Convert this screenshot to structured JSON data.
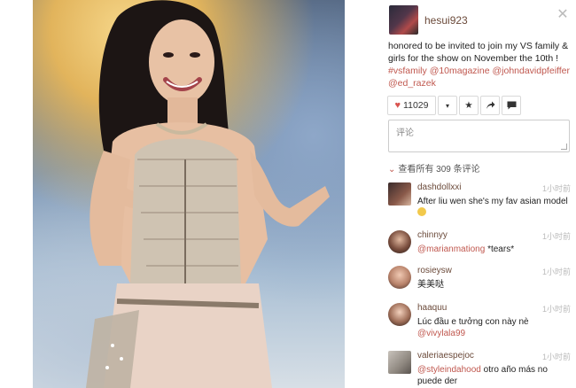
{
  "post": {
    "username": "hesui923",
    "caption_text": "honored to be invited to join my VS family & girls for the show on November the 10th !",
    "tags": [
      "#vsfamily",
      "@10magazine",
      "@johndavidpfeiffer",
      "@ed_razek"
    ],
    "like_count": "11029",
    "comment_placeholder": "评论",
    "view_all": "查看所有 309 条评论"
  },
  "comments": [
    {
      "user": "dashdollxxi",
      "time": "1小时前",
      "text": "After liu wen she's my fav asian model",
      "mention": "",
      "emoji": true
    },
    {
      "user": "chinnyy",
      "time": "1小时前",
      "mention": "@marianmationg",
      "text": "*tears*",
      "emoji": false
    },
    {
      "user": "rosieysw",
      "time": "1小时前",
      "mention": "",
      "text": "美美哒",
      "emoji": false
    },
    {
      "user": "haaquu",
      "time": "1小时前",
      "mention": "",
      "text": "Lúc đầu e tưởng con này nè",
      "mention2": "@vivylala99",
      "emoji": false
    },
    {
      "user": "valeriaespejoc",
      "time": "1小时前",
      "mention": "@styleindahood",
      "text": "otro año más no puede der",
      "emoji": false
    }
  ],
  "icons": {
    "like": "heart-icon",
    "more": "caret-down-icon",
    "favorite": "star-icon",
    "share": "share-arrow-icon",
    "comment": "speech-bubble-icon",
    "close": "close-icon"
  },
  "colors": {
    "link": "#c0584f",
    "username": "#6b4a3a",
    "heart": "#d9534f"
  }
}
